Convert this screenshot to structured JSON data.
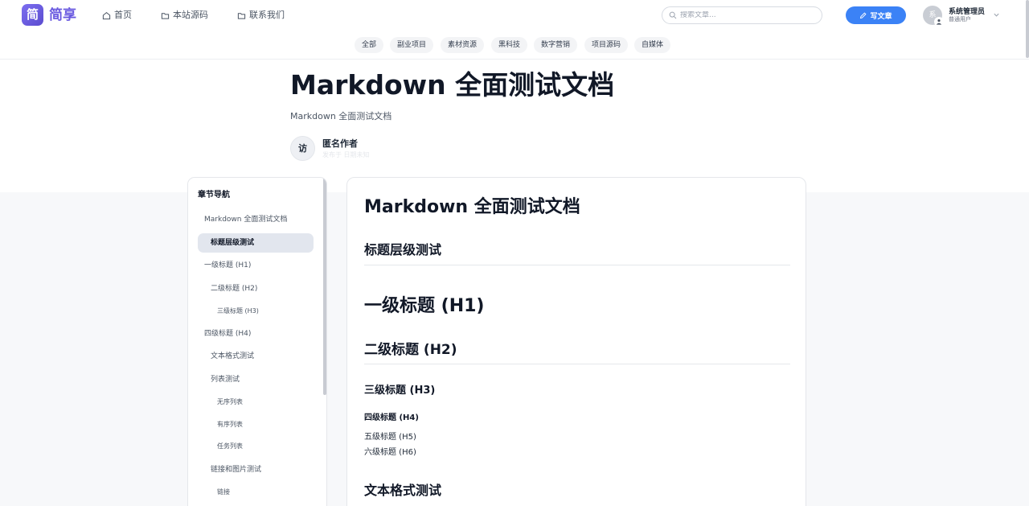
{
  "header": {
    "logo_char": "简",
    "logo_text": "简享",
    "nav": [
      "首页",
      "本站源码",
      "联系我们"
    ],
    "search_placeholder": "搜索文章...",
    "write_label": "写文章",
    "avatar_char": "系",
    "user_name": "系统管理员",
    "user_role": "普通用户"
  },
  "categories": [
    "全部",
    "副业项目",
    "素材资源",
    "黑科技",
    "数字营销",
    "项目源码",
    "自媒体"
  ],
  "article": {
    "title": "Markdown 全面测试文档",
    "subtitle": "Markdown 全面测试文档",
    "author_avatar": "访",
    "author_name": "匿名作者",
    "author_meta": "发布于 日期未知"
  },
  "toc": {
    "heading": "章节导航",
    "items": [
      "Markdown 全面测试文档",
      "标题层级测试",
      "一级标题 (H1)",
      "二级标题 (H2)",
      "三级标题 (H3)",
      "四级标题 (H4)",
      "文本格式测试",
      "列表测试",
      "无序列表",
      "有序列表",
      "任务列表",
      "链接和图片测试",
      "链接"
    ],
    "active_index": 1
  },
  "content": {
    "h1": "Markdown 全面测试文档",
    "sec_title": "标题层级测试",
    "h1_sample": "一级标题 (H1)",
    "h2_sample": "二级标题 (H2)",
    "h3_sample": "三级标题 (H3)",
    "h4_sample": "四级标题 (H4)",
    "h5_sample": "五级标题 (H5)",
    "h6_sample": "六级标题 (H6)",
    "sec2_title": "文本格式测试"
  }
}
